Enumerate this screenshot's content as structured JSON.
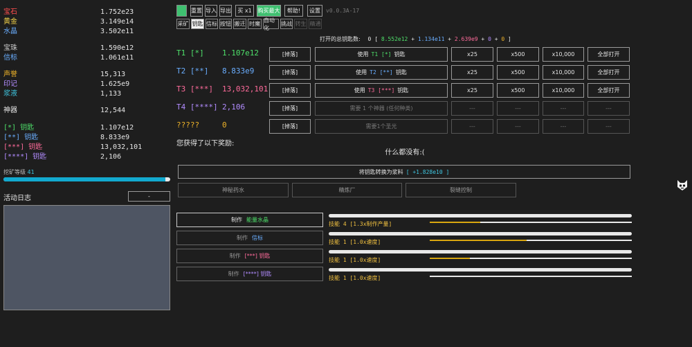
{
  "resources": [
    {
      "label": "宝石",
      "value": "1.752e23",
      "color": "#ff4d4d"
    },
    {
      "label": "黄金",
      "value": "3.149e14",
      "color": "#f2d24a"
    },
    {
      "label": "水晶",
      "value": "3.502e11",
      "color": "#6aaeff"
    },
    {
      "label": "宝珠",
      "value": "1.590e12",
      "color": "#cccccc"
    },
    {
      "label": "信标",
      "value": "1.061e11",
      "color": "#6aaeff"
    },
    {
      "label": "声誉",
      "value": "15,313",
      "color": "#f0b429"
    },
    {
      "label": "印记",
      "value": "1.625e9",
      "color": "#b28cff"
    },
    {
      "label": "浆液",
      "value": "1,133",
      "color": "#3fc6e0"
    },
    {
      "label": "神器",
      "value": "12,544",
      "color": "#e6e6e6"
    },
    {
      "label": "[*] 钥匙",
      "value": "1.107e12",
      "color": "#4ee06a"
    },
    {
      "label": "[**] 钥匙",
      "value": "8.833e9",
      "color": "#6aaeff"
    },
    {
      "label": "[***] 钥匙",
      "value": "13,032,101",
      "color": "#ff6b9b"
    },
    {
      "label": "[****] 钥匙",
      "value": "2,106",
      "color": "#b28cff"
    }
  ],
  "mining": {
    "label": "挖矿等级",
    "level": "41",
    "progress": 0.97
  },
  "log": {
    "title": "活动日志",
    "toggle": "-"
  },
  "toolbar": {
    "buttons": [
      "重置",
      "导入",
      "导出",
      "买 x1",
      "购买最大",
      "帮助!",
      "设置"
    ],
    "version": "v0.0.3A-17"
  },
  "tabs": [
    "采矿",
    "钥匙",
    "信标",
    "按钮",
    "搬迁",
    "时魔",
    "自动化",
    "挑战",
    "转生",
    "精通"
  ],
  "total_keys": {
    "prefix": "打开的总钥匙数:",
    "zero": "0",
    "lbr": "[",
    "v1": "8.552e12",
    "plus": "+",
    "v2": "1.134e11",
    "v3": "2.639e9",
    "v4": "0",
    "v5": "0",
    "rbr": "]"
  },
  "tiers": [
    {
      "name": "T1 [*]",
      "value": "1.107e12",
      "color": "#4ee06a",
      "drop": "[掉落]",
      "use_pre": "使用",
      "use_key": "T1 [*]",
      "use_post": "钥匙",
      "x25": "x25",
      "x500": "x500",
      "x10000": "x10,000",
      "all": "全部打开",
      "active": true
    },
    {
      "name": "T2 [**]",
      "value": "8.833e9",
      "color": "#6aaeff",
      "drop": "[掉落]",
      "use_pre": "使用",
      "use_key": "T2 [**]",
      "use_post": "钥匙",
      "x25": "x25",
      "x500": "x500",
      "x10000": "x10,000",
      "all": "全部打开",
      "active": true
    },
    {
      "name": "T3 [***]",
      "value": "13,032,101",
      "color": "#ff6b9b",
      "drop": "[掉落]",
      "use_pre": "使用",
      "use_key": "T3 [***]",
      "use_post": "钥匙",
      "x25": "x25",
      "x500": "x500",
      "x10000": "x10,000",
      "all": "全部打开",
      "active": true
    },
    {
      "name": "T4 [****]",
      "value": "2,106",
      "color": "#b28cff",
      "drop": "[掉落]",
      "need": "需要 1 个神器 (任何种类)",
      "dash": "---",
      "active": false
    },
    {
      "name": "?????",
      "value": "0",
      "color": "#f0b429",
      "drop": "[掉落]",
      "need": "需要1个圣光",
      "dash": "---",
      "active": false
    }
  ],
  "rewards": {
    "title": "您获得了以下奖励:",
    "empty": "什么都没有:("
  },
  "convert": {
    "label": "将钥匙转换为浆料",
    "amount": "[ +1.828e10 ]"
  },
  "features": [
    "神秘药水",
    "精炼厂",
    "裂缝控制"
  ],
  "crafts": [
    {
      "pre": "制作",
      "item": "能量水晶",
      "color": "#4ee06a",
      "active": true
    },
    {
      "pre": "制作",
      "item": "信标",
      "color": "#6aaeff",
      "active": false
    },
    {
      "pre": "制作",
      "item": "[***] 钥匙",
      "color": "#ff6b9b",
      "active": false
    },
    {
      "pre": "制作",
      "item": "[****] 钥匙",
      "color": "#b28cff",
      "active": false
    }
  ],
  "skills": [
    {
      "label": "技能 4 [1.3x制作产量]",
      "fill": 0.25
    },
    {
      "label": "技能 1 [1.0x速度]",
      "fill": 0.48
    },
    {
      "label": "技能 1 [1.0x速度]",
      "fill": 0.2
    },
    {
      "label": "技能 1 [1.0x速度]",
      "fill": 0.0
    }
  ]
}
